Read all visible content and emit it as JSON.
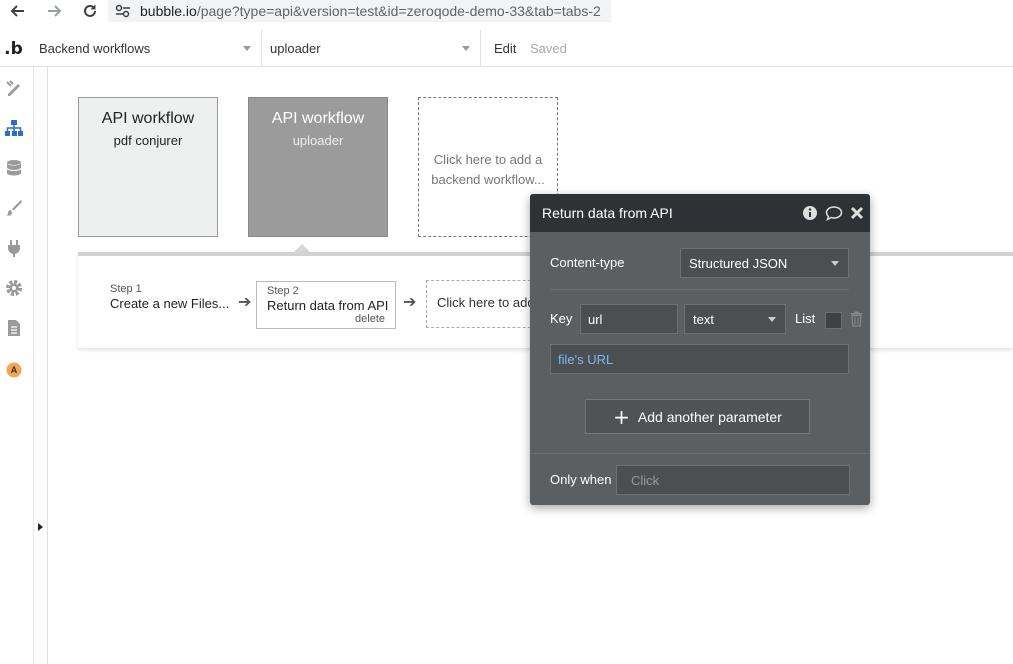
{
  "browser": {
    "url_host": "bubble.io",
    "url_path": "/page?type=api&version=test&id=zeroqode-demo-33&tab=tabs-2"
  },
  "topbar": {
    "logo": ".b",
    "section_dropdown": "Backend workflows",
    "workflow_dropdown": "uploader",
    "edit_label": "Edit",
    "saved_label": "Saved"
  },
  "sidebar": {
    "items": [
      "design-icon",
      "workflow-icon",
      "data-icon",
      "styles-icon",
      "plugins-icon",
      "settings-icon",
      "logs-icon",
      "account-avatar"
    ],
    "avatar_letter": "A"
  },
  "workflows": [
    {
      "title": "API workflow",
      "name": "pdf conjurer"
    },
    {
      "title": "API workflow",
      "name": "uploader"
    }
  ],
  "add_workflow": {
    "line1": "Click here to add a",
    "line2": "backend workflow..."
  },
  "steps": [
    {
      "number": "Step 1",
      "label": "Create a new Files..."
    },
    {
      "number": "Step 2",
      "label": "Return data from API",
      "delete": "delete"
    }
  ],
  "add_step": "Click here to add",
  "editor": {
    "title": "Return data from API",
    "content_type_label": "Content-type",
    "content_type_value": "Structured JSON",
    "key_label": "Key",
    "key_value": "url",
    "type_value": "text",
    "list_label": "List",
    "expression": "file's URL",
    "add_param": "Add another parameter",
    "only_when_label": "Only when",
    "only_when_placeholder": "Click"
  },
  "colors": {
    "editor_bg": "#5b5f62",
    "editor_header": "#2e3236",
    "expression_blue": "#7db8f0",
    "selected_workflow": "#9b9b9b"
  }
}
